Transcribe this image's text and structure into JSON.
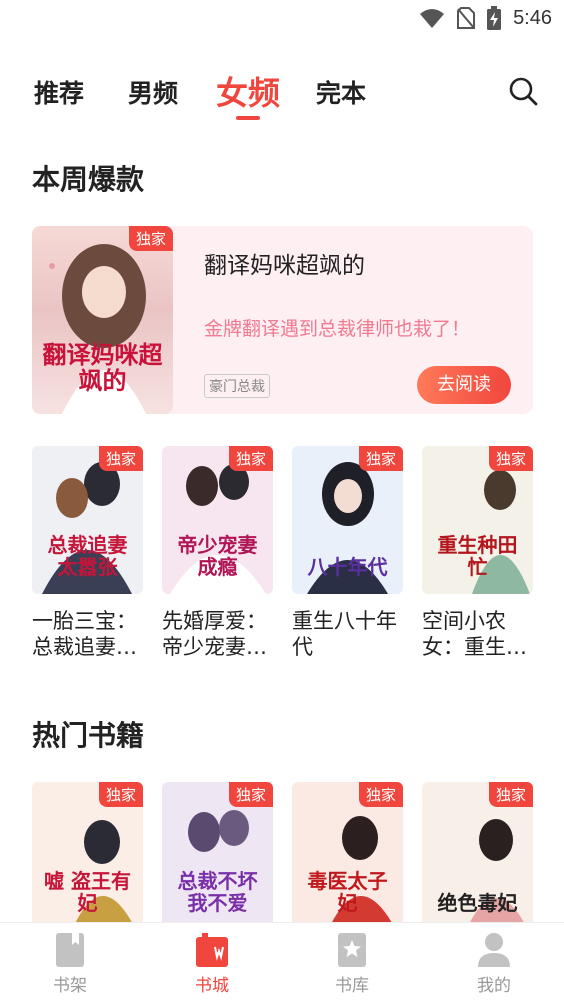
{
  "status_bar": {
    "time": "5:46"
  },
  "tabs": [
    {
      "label": "推荐"
    },
    {
      "label": "男频"
    },
    {
      "label": "女频"
    },
    {
      "label": "完本"
    }
  ],
  "weekly_hot": {
    "section_title": "本周爆款",
    "featured": {
      "cover_text": "翻译妈咪超飒的",
      "badge": "独家",
      "title": "翻译妈咪超飒的",
      "description": "金牌翻译遇到总裁律师也栽了！",
      "tag": "豪门总裁",
      "read_button": "去阅读"
    },
    "books": [
      {
        "badge": "独家",
        "cover_text": "总裁追妻太嚣张",
        "title": "一胎三宝：总裁追妻…"
      },
      {
        "badge": "独家",
        "cover_text": "帝少宠妻成瘾",
        "title": "先婚厚爱：帝少宠妻…"
      },
      {
        "badge": "独家",
        "cover_text": "八十年代",
        "title": "重生八十年代"
      },
      {
        "badge": "独家",
        "cover_text": "重生种田忙",
        "title": "空间小农女：重生…"
      }
    ]
  },
  "hot_books": {
    "section_title": "热门书籍",
    "books": [
      {
        "badge": "独家",
        "cover_text": "嘘 盗王有妃"
      },
      {
        "badge": "独家",
        "cover_text": "总裁不坏我不爱"
      },
      {
        "badge": "独家",
        "cover_text": "毒医太子妃"
      },
      {
        "badge": "独家",
        "cover_text": "绝色毒妃"
      }
    ]
  },
  "bottom_nav": [
    {
      "label": "书架",
      "icon": "bookshelf-icon"
    },
    {
      "label": "书城",
      "icon": "bookstore-icon"
    },
    {
      "label": "书库",
      "icon": "library-icon"
    },
    {
      "label": "我的",
      "icon": "profile-icon"
    }
  ],
  "colors": {
    "accent": "#f0463d",
    "featured_bg": "#fdeff2",
    "description": "#f17a90"
  }
}
